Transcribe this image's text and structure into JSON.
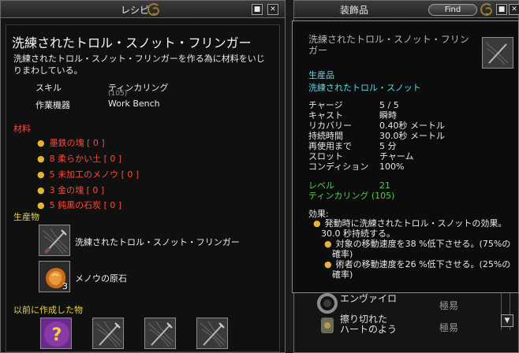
{
  "recipe_window": {
    "title": "レシピ",
    "item_title": "洗練されたトロル・スノット・フリンガー",
    "description": "洗練されたトロル・スノット・フリンガーを作る為に材料をいじりまわしている。",
    "skill_label": "スキル",
    "skill_value": "ティンカリング",
    "skill_level": "(105)",
    "device_label": "作業機器",
    "device_value": "Work Bench",
    "materials_header": "材料",
    "materials": [
      "墨鉄の塊 [ 0 ]",
      "8 柔らかい土 [ 0 ]",
      "5 未加工のメノウ [ 0 ]",
      "3 金の塊 [ 0 ]",
      "5 鈍黒の石炭 [ 0 ]"
    ],
    "products_header": "生産物",
    "products": [
      {
        "label": "洗練されたトロル・スノット・フリンガー",
        "icon": "snot-flinger-icon",
        "count": ""
      },
      {
        "label": "メノウの原石",
        "icon": "agate-icon",
        "count": "3"
      }
    ],
    "previous_header": "以前に作成した物",
    "previous_items": [
      "unknown-recipe-icon",
      "snot-flinger-icon",
      "snot-flinger-icon",
      "snot-flinger-icon"
    ],
    "previous_unknown_glyph": "?"
  },
  "accessory_window": {
    "title": "装飾品",
    "find_label": "Find",
    "list": [
      {
        "name": "エンヴァイロ",
        "grade": "極易",
        "icon": "gear-ring-icon"
      },
      {
        "name": "擦り切れた\nハートのよう",
        "grade": "極易",
        "icon": "amulet-icon"
      }
    ]
  },
  "tooltip": {
    "name": "洗練されたトロル・スノット・フリンガー",
    "category": "生産品",
    "source": "洗練されたトロル・スノット",
    "stats": [
      {
        "k": "チャージ",
        "v": "5 / 5"
      },
      {
        "k": "キャスト",
        "v": "瞬時"
      },
      {
        "k": "リカバリー",
        "v": "0.40秒 メートル"
      },
      {
        "k": "持続時間",
        "v": "30.0秒 メートル"
      },
      {
        "k": "再使用まで",
        "v": "5 分"
      },
      {
        "k": "スロット",
        "v": "チャーム"
      },
      {
        "k": "コンディション",
        "v": "100%"
      }
    ],
    "level_label": "レベル",
    "level_value": "21",
    "skill_req": "ティンカリング (105)",
    "effect_header": "効果:",
    "effect_line1": "発動時に洗練されたトロル・スノットの効果。",
    "effect_line2": "30.0 秒持続する。",
    "sub_effects": [
      [
        "対象の移動速度を38 %低下させる。(75%の",
        "確率)"
      ],
      [
        "術者の移動速度を26 %低下させる。(25%の",
        "確率)"
      ]
    ]
  },
  "colors": {
    "material_red": "#ff4a3a",
    "header_red": "#ff4a3a",
    "header_yellow": "#e8d34a",
    "cyan": "#5cdbe3",
    "green": "#4fd14f",
    "gold": "#9a7a35"
  }
}
